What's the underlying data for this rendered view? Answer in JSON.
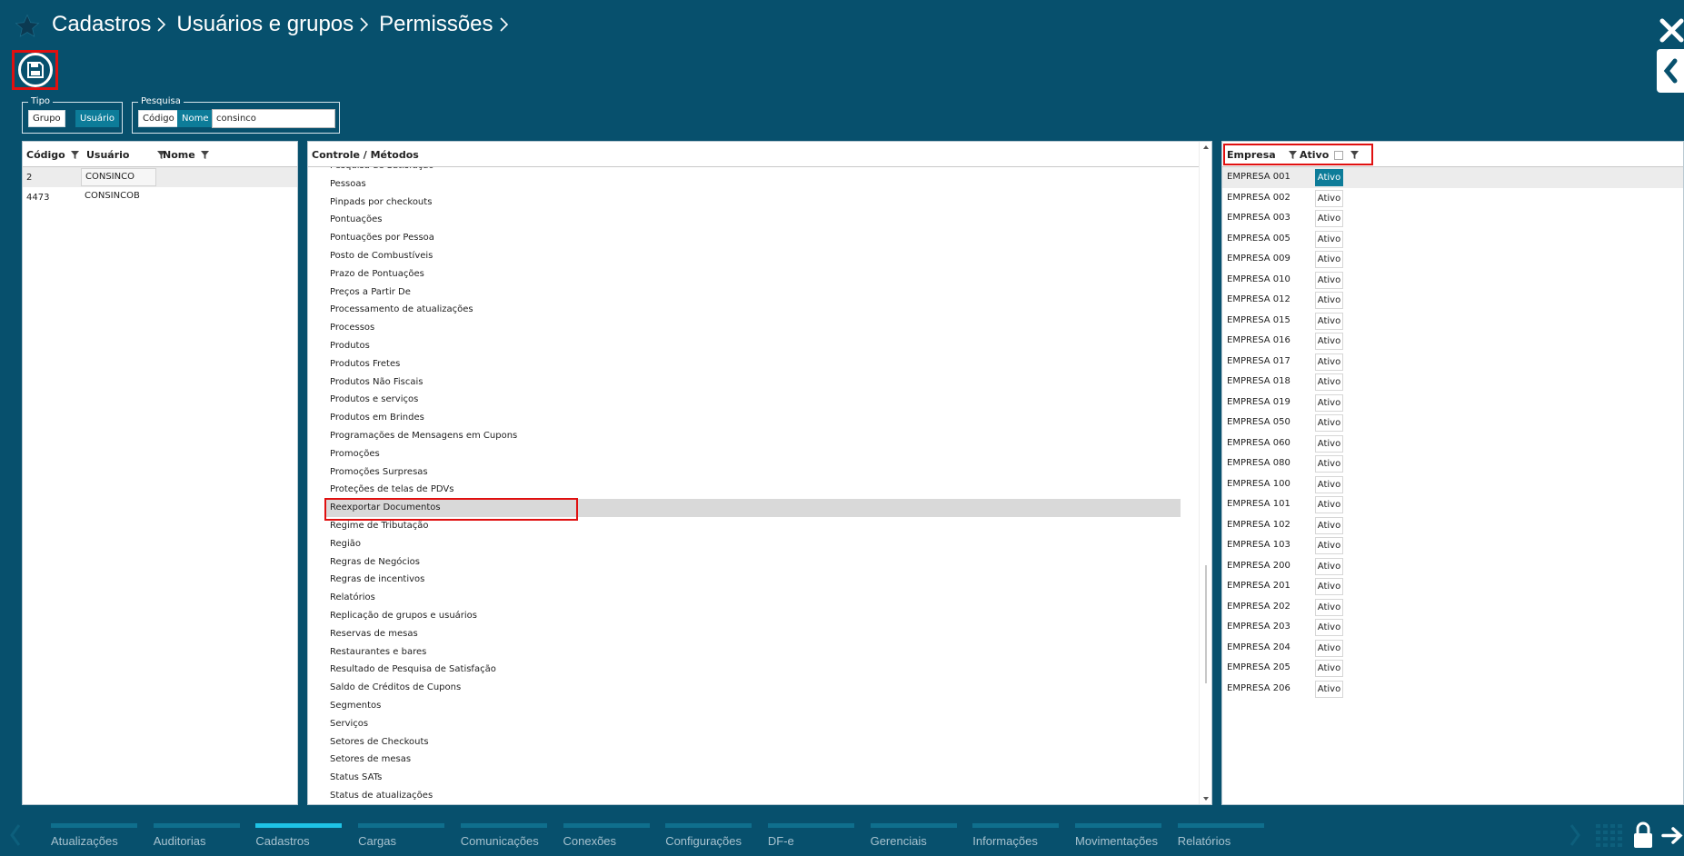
{
  "breadcrumb": [
    "Cadastros",
    "Usuários e grupos",
    "Permissões"
  ],
  "filters": {
    "tipo_legend": "Tipo",
    "tipo_options": [
      "Grupo",
      "Usuário"
    ],
    "tipo_selected": "Usuário",
    "pesquisa_legend": "Pesquisa",
    "pesquisa_options": [
      "Código",
      "Nome"
    ],
    "pesquisa_selected": "Nome",
    "search_value": "consinco"
  },
  "users": {
    "columns": [
      "Código",
      "Usuário",
      "Nome"
    ],
    "rows": [
      {
        "codigo": "2",
        "usuario": "CONSINCO",
        "nome": ""
      },
      {
        "codigo": "4473",
        "usuario": "CONSINCOB",
        "nome": ""
      }
    ]
  },
  "controle": {
    "header": "Controle / Métodos",
    "items": [
      "Pesquisa de Satisfação",
      "Pessoas",
      "Pinpads por checkouts",
      "Pontuações",
      "Pontuações por Pessoa",
      "Posto de Combustíveis",
      "Prazo de Pontuações",
      "Preços a Partir De",
      "Processamento de atualizações",
      "Processos",
      "Produtos",
      "Produtos Fretes",
      "Produtos Não Fiscais",
      "Produtos e serviços",
      "Produtos em Brindes",
      "Programações de Mensagens em Cupons",
      "Promoções",
      "Promoções Surpresas",
      "Proteções de telas de PDVs",
      "Reexportar Documentos",
      "Regime de Tributação",
      "Região",
      "Regras de Negócios",
      "Regras de incentivos",
      "Relatórios",
      "Replicação de grupos e usuários",
      "Reservas de mesas",
      "Restaurantes e bares",
      "Resultado de Pesquisa de Satisfação",
      "Saldo de Créditos de Cupons",
      "Segmentos",
      "Serviços",
      "Setores de Checkouts",
      "Setores de mesas",
      "Status SATs",
      "Status de atualizações"
    ],
    "selected": "Reexportar Documentos"
  },
  "empresas": {
    "columns": [
      "Empresa",
      "Ativo"
    ],
    "badge_label": "Ativo",
    "rows": [
      "EMPRESA 001",
      "EMPRESA 002",
      "EMPRESA 003",
      "EMPRESA 005",
      "EMPRESA 009",
      "EMPRESA 010",
      "EMPRESA 012",
      "EMPRESA 015",
      "EMPRESA 016",
      "EMPRESA 017",
      "EMPRESA 018",
      "EMPRESA 019",
      "EMPRESA 050",
      "EMPRESA 060",
      "EMPRESA 080",
      "EMPRESA 100",
      "EMPRESA 101",
      "EMPRESA 102",
      "EMPRESA 103",
      "EMPRESA 200",
      "EMPRESA 201",
      "EMPRESA 202",
      "EMPRESA 203",
      "EMPRESA 204",
      "EMPRESA 205",
      "EMPRESA 206"
    ],
    "active_row": "EMPRESA 001"
  },
  "bottom_nav": {
    "tabs": [
      "Atualizações",
      "Auditorias",
      "Cadastros",
      "Cargas",
      "Comunicações",
      "Conexões",
      "Configurações",
      "DF-e",
      "Gerenciais",
      "Informações",
      "Movimentações",
      "Relatórios"
    ],
    "active": "Cadastros"
  },
  "colors": {
    "background": "#07506d",
    "accent": "#0d7c99",
    "active_tab": "#1ec3e6",
    "highlight": "#e01010"
  },
  "icons": [
    "star-icon",
    "chevron-right-icon",
    "close-icon",
    "chevron-left-icon",
    "save-icon",
    "filter-icon",
    "grid-icon",
    "lock-icon",
    "logout-icon"
  ]
}
